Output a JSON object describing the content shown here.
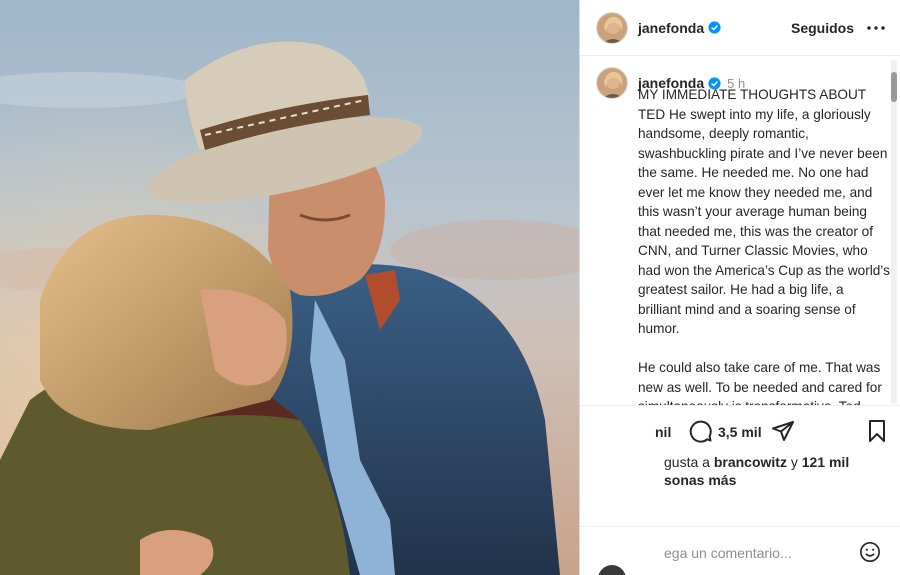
{
  "post": {
    "username": "janefonda",
    "follow_status": "Seguidos",
    "time_ago": "5 h",
    "caption": "MY IMMEDIATE THOUGHTS ABOUT TED He swept into my life, a gloriously handsome, deeply romantic, swashbuckling pirate and I’ve never been the same. He needed me. No one had ever let me know they needed me, and this wasn’t your average human being that needed me, this was the creator of CNN, and Turner Classic Movies, who had won the America’s Cup as the world’s greatest sailor. He had a big life, a brilliant mind and a soaring sense of humor.\n\nHe could also take care of me. That was new as well. To be needed and cared for simultaneously is transformative. Ted Turner helped me believe in myself. He"
  },
  "actions": {
    "like_fragment": "nil",
    "comment_count": "3,5 mil"
  },
  "likes": {
    "prefix": "gusta a",
    "liker": "brancowitz",
    "connector": "y",
    "others": "121 mil",
    "suffix": "sonas más"
  },
  "comment_box": {
    "placeholder": "ega un comentario..."
  },
  "icons": {
    "verified": "verified-badge-icon",
    "more": "more-options-icon",
    "comment": "comment-bubble-icon",
    "share": "share-paper-plane-icon",
    "save": "bookmark-icon",
    "emoji": "emoji-smile-icon"
  },
  "colors": {
    "verified_blue": "#0095f6",
    "text": "#262626",
    "muted": "#8e8e8e"
  }
}
